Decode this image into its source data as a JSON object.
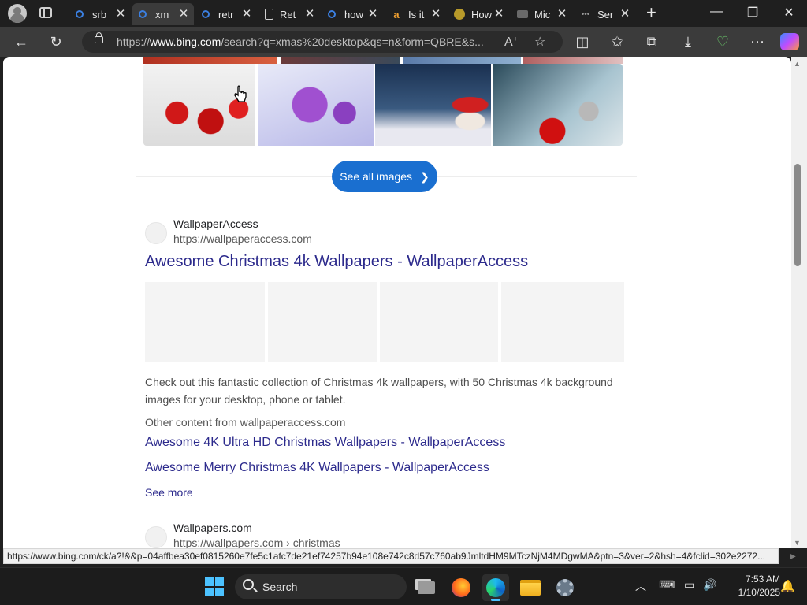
{
  "browser": {
    "tabs": [
      {
        "title": "srb",
        "favicon": "bing-icon",
        "active": false
      },
      {
        "title": "xm",
        "favicon": "bing-icon",
        "active": true
      },
      {
        "title": "retr",
        "favicon": "bing-icon",
        "active": false
      },
      {
        "title": "Ret",
        "favicon": "document-icon",
        "active": false
      },
      {
        "title": "how",
        "favicon": "bing-icon",
        "active": false
      },
      {
        "title": "Is it",
        "favicon": "amazon-icon",
        "active": false
      },
      {
        "title": "How",
        "favicon": "site-icon",
        "active": false
      },
      {
        "title": "Mic",
        "favicon": "microphone-icon",
        "active": false
      },
      {
        "title": "Ser",
        "favicon": "dots-icon",
        "active": false
      }
    ],
    "url_prefix": "https://",
    "url_host": "www.bing.com",
    "url_rest": "/search?q=xmas%20desktop&qs=n&form=QBRE&s..."
  },
  "page": {
    "see_all_images": "See all images",
    "result1": {
      "site_name": "WallpaperAccess",
      "site_url": "https://wallpaperaccess.com",
      "title": "Awesome Christmas 4k Wallpapers - WallpaperAccess",
      "snippet": "Check out this fantastic collection of Christmas 4k wallpapers, with 50 Christmas 4k background images for your desktop, phone or tablet.",
      "other_content": "Other content from wallpaperaccess.com",
      "sublinks": [
        "Awesome 4K Ultra HD Christmas Wallpapers - WallpaperAccess",
        "Awesome Merry Christmas 4K Wallpapers - WallpaperAccess"
      ],
      "see_more": "See more"
    },
    "result2": {
      "site_name": "Wallpapers.com",
      "site_url": "https://wallpapers.com › christmas"
    }
  },
  "status_bar": "https://www.bing.com/ck/a?!&&p=04affbea30ef0815260e7fe5c1afc7de21ef74257b94e108e742c8d57c760ab9JmltdHM9MTczNjM4MDgwMA&ptn=3&ver=2&hsh=4&fclid=302e2272...",
  "taskbar": {
    "search_label": "Search",
    "time": "7:53 AM",
    "date": "1/10/2025"
  },
  "colors": {
    "link": "#2c2a8c",
    "accent": "#1a6fd0",
    "windows_accent": "#4cc2ff"
  }
}
